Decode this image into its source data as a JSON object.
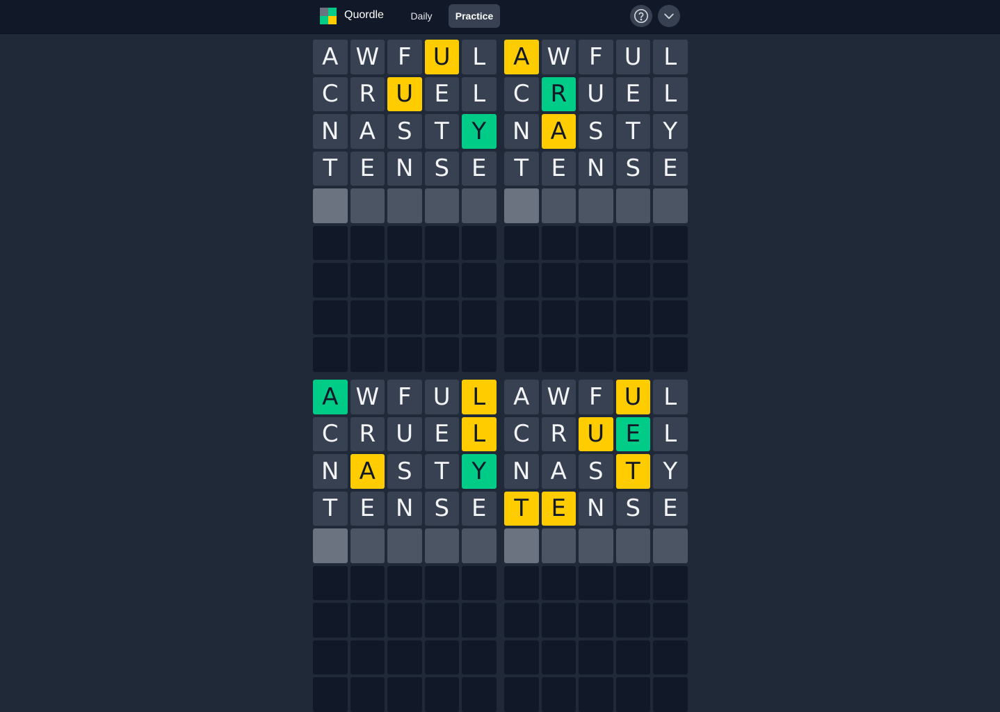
{
  "header": {
    "brand": "Quordle",
    "nav": {
      "daily": "Daily",
      "practice": "Practice"
    },
    "icons": {
      "help": "help-circle-icon",
      "menu": "chevron-down-icon"
    },
    "logo_colors": [
      "#6b7280",
      "#00cc88",
      "#00cc88",
      "#ffcc00"
    ]
  },
  "colors": {
    "correct": "#00cc88",
    "present": "#ffcc00",
    "absent": "#374151",
    "background": "#1f2937",
    "empty": "#111827"
  },
  "game": {
    "guesses": [
      "AWFUL",
      "CRUEL",
      "NASTY",
      "TENSE"
    ],
    "boards": [
      {
        "states": [
          "aaaya",
          "aayaa",
          "aaaag",
          "aaaaa"
        ]
      },
      {
        "states": [
          "yaaaa",
          "agaaa",
          "ayaaa",
          "aaaaa"
        ]
      },
      {
        "states": [
          "gaaay",
          "aaaay",
          "ayaag",
          "aaaaa"
        ]
      },
      {
        "states": [
          "aaaya",
          "aayga",
          "aaaya",
          "yyaaa"
        ]
      }
    ]
  }
}
